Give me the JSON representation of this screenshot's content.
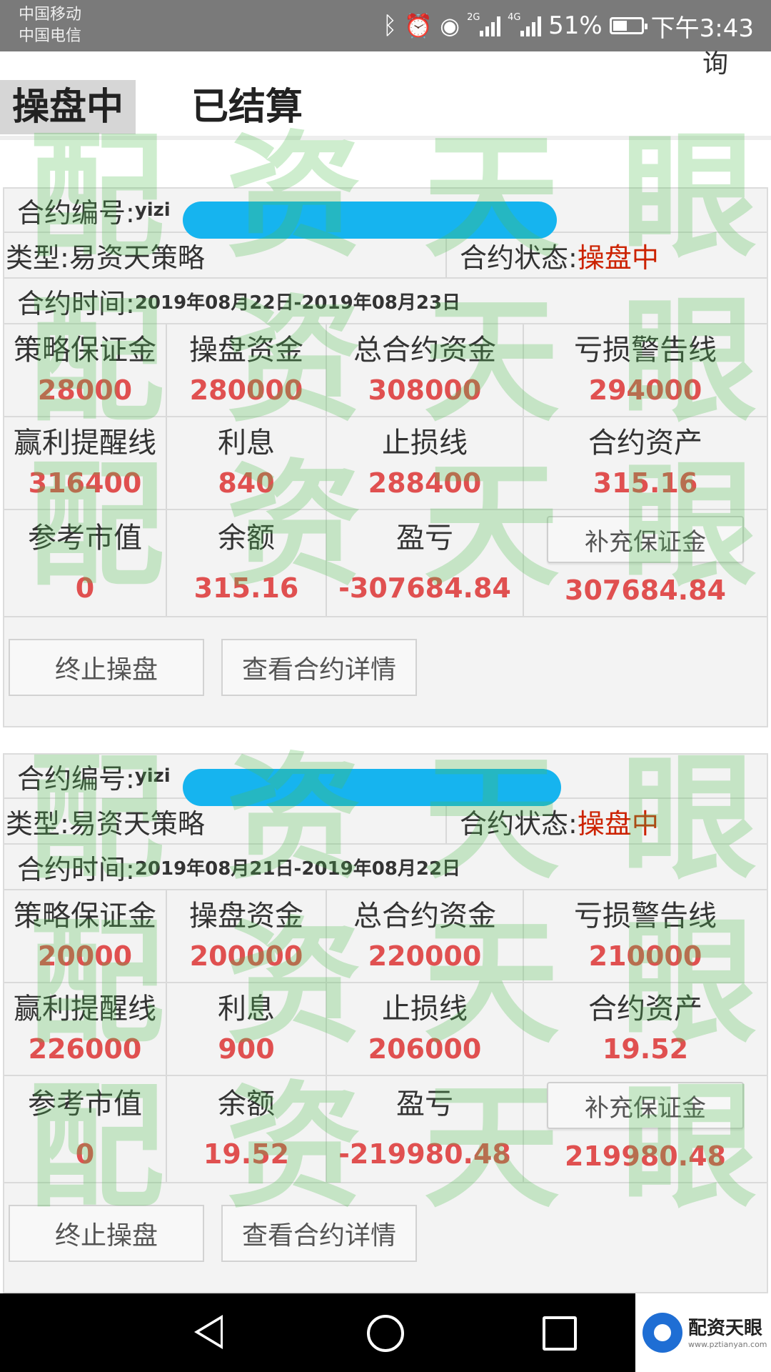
{
  "status_bar": {
    "carrier_1": "中国移动",
    "carrier_2": "中国电信",
    "signal_1_label": "2G",
    "signal_2_label": "4G",
    "battery": "51%",
    "battery_level": 0.51,
    "time": "下午3:43"
  },
  "header": {
    "tab_active": "操盘中",
    "tab_other": "已结算",
    "cut_char": "询"
  },
  "watermark": {
    "text": [
      "配",
      "资",
      "天",
      "眼"
    ]
  },
  "labels": {
    "contract_no": "合约编号: ",
    "type": "类型: ",
    "contract_status": "合约状态: ",
    "contract_time": "合约时间: ",
    "margin": "策略保证金",
    "trading_funds": "操盘资金",
    "total_funds": "总合约资金",
    "loss_warning": "亏损警告线",
    "profit_alert": "赢利提醒线",
    "interest": "利息",
    "stop_loss": "止损线",
    "contract_assets": "合约资产",
    "market_value": "参考市值",
    "balance": "余额",
    "pnl": "盈亏",
    "add_margin_button": "补充保证金",
    "terminate_button": "终止操盘",
    "detail_button": "查看合约详情"
  },
  "contracts": [
    {
      "contract_no_prefix": "yizi",
      "type": "易资天策略",
      "status": "操盘中",
      "time": "2019年08月22日-2019年08月23日",
      "margin": "28000",
      "trading_funds": "280000",
      "total_funds": "308000",
      "loss_warning": "294000",
      "profit_alert": "316400",
      "interest": "840",
      "stop_loss": "288400",
      "contract_assets": "315.16",
      "market_value": "0",
      "balance": "315.16",
      "pnl": "-307684.84",
      "add_margin_amount": "307684.84"
    },
    {
      "contract_no_prefix": "yizi",
      "type": "易资天策略",
      "status": "操盘中",
      "time": "2019年08月21日-2019年08月22日",
      "margin": "20000",
      "trading_funds": "200000",
      "total_funds": "220000",
      "loss_warning": "210000",
      "profit_alert": "226000",
      "interest": "900",
      "stop_loss": "206000",
      "contract_assets": "19.52",
      "market_value": "0",
      "balance": "19.52",
      "pnl": "-219980.48",
      "add_margin_amount": "219980.48"
    }
  ],
  "logo": {
    "name": "配资天眼",
    "url": "www.pztianyan.com"
  },
  "colors": {
    "value_red": "#e05050",
    "status_red": "#cc2200",
    "redaction_blue": "#16b4ef",
    "watermark_green": "#50be50"
  }
}
